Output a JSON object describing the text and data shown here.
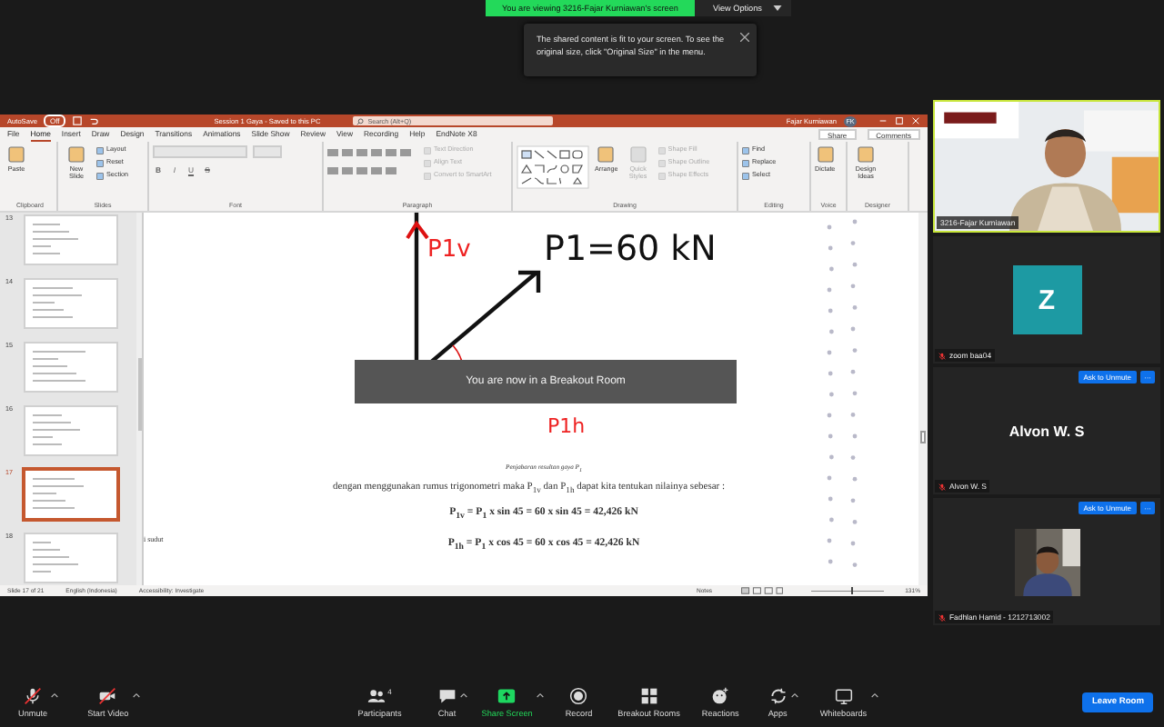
{
  "share_banner": {
    "text": "You are viewing 3216-Fajar Kurniawan's screen",
    "button": "View Options"
  },
  "tooltip": {
    "text": "The shared content is fit to your screen. To see the original size, click \"Original Size\" in the menu."
  },
  "powerpoint": {
    "title_bar": {
      "autosave": "AutoSave",
      "autosave_state": "Off",
      "document": "Session 1 Gaya  -  Saved to this PC",
      "search_placeholder": "Search (Alt+Q)",
      "user": "Fajar Kurniawan",
      "avatar": "FK"
    },
    "tabs": [
      {
        "label": "File",
        "selected": false
      },
      {
        "label": "Home",
        "selected": true
      },
      {
        "label": "Insert",
        "selected": false
      },
      {
        "label": "Draw",
        "selected": false
      },
      {
        "label": "Design",
        "selected": false
      },
      {
        "label": "Transitions",
        "selected": false
      },
      {
        "label": "Animations",
        "selected": false
      },
      {
        "label": "Slide Show",
        "selected": false
      },
      {
        "label": "Review",
        "selected": false
      },
      {
        "label": "View",
        "selected": false
      },
      {
        "label": "Recording",
        "selected": false
      },
      {
        "label": "Help",
        "selected": false
      },
      {
        "label": "EndNote X8",
        "selected": false
      }
    ],
    "share": "Share",
    "comments": "Comments",
    "ribbon": [
      {
        "kind": "plain",
        "label": "Clipboard",
        "items": [
          {
            "label": "Paste",
            "kind": "large",
            "disabled": false
          }
        ]
      },
      {
        "kind": "plain",
        "label": "Slides",
        "items": [
          {
            "label": "New Slide",
            "kind": "large",
            "disabled": false
          },
          {
            "label": "Layout",
            "kind": "small",
            "disabled": false
          },
          {
            "label": "Reset",
            "kind": "small",
            "disabled": false
          },
          {
            "label": "Section",
            "kind": "small",
            "disabled": false
          }
        ]
      },
      {
        "kind": "font",
        "label": "Font",
        "format_buttons": [
          "B",
          "I",
          "U",
          "S"
        ]
      },
      {
        "kind": "paragraph",
        "label": "Paragraph",
        "items": [
          {
            "label": "Text Direction",
            "kind": "small",
            "disabled": true
          },
          {
            "label": "Align Text",
            "kind": "small",
            "disabled": true
          },
          {
            "label": "Convert to SmartArt",
            "kind": "small",
            "disabled": true
          }
        ]
      },
      {
        "kind": "drawing",
        "label": "Drawing",
        "items": [
          {
            "label": "Arrange",
            "kind": "large",
            "disabled": false
          },
          {
            "label": "Quick Styles",
            "kind": "large",
            "disabled": true
          },
          {
            "label": "Shape Fill",
            "kind": "small",
            "disabled": true
          },
          {
            "label": "Shape Outline",
            "kind": "small",
            "disabled": true
          },
          {
            "label": "Shape Effects",
            "kind": "small",
            "disabled": true
          }
        ]
      },
      {
        "kind": "plain",
        "label": "Editing",
        "items": [
          {
            "label": "Find",
            "kind": "small",
            "disabled": false
          },
          {
            "label": "Replace",
            "kind": "small",
            "disabled": false
          },
          {
            "label": "Select",
            "kind": "small",
            "disabled": false
          }
        ]
      },
      {
        "kind": "plain",
        "label": "Voice",
        "items": [
          {
            "label": "Dictate",
            "kind": "large",
            "disabled": false
          }
        ]
      },
      {
        "kind": "plain",
        "label": "Designer",
        "items": [
          {
            "label": "Design Ideas",
            "kind": "large",
            "disabled": false
          }
        ]
      }
    ],
    "thumbnails": [
      {
        "number": "13",
        "selected": false
      },
      {
        "number": "14",
        "selected": false
      },
      {
        "number": "15",
        "selected": false
      },
      {
        "number": "16",
        "selected": false
      },
      {
        "number": "17",
        "selected": true
      },
      {
        "number": "18",
        "selected": false
      }
    ],
    "slide": {
      "ink_force": "P1=60 kN",
      "ink_vertical": "P1v",
      "ink_horizontal": "P1h",
      "side_text": "i sudut",
      "caption": "Penjabaran resultan gaya P$_{1}$",
      "paragraph": "dengan menggunakan rumus trigonometri maka P$_{1v}$ dan P$_{1h}$ dapat kita tentukan nilainya sebesar :",
      "equations": [
        "P$_{1v}$ = P$_{1}$ x sin 45 = 60 x sin 45 = 42,426 kN",
        "P$_{1h}$ = P$_{1}$ x cos 45 = 60 x cos 45 = 42,426 kN"
      ]
    },
    "overlay": "You are now in a Breakout Room",
    "status_bar": {
      "slide": "Slide 17 of 21",
      "language": "English (Indonesia)",
      "accessibility": "Accessibility: Investigate",
      "notes": "Notes",
      "zoom_slider": {
        "level": 0.55
      },
      "zoom": "131%"
    }
  },
  "participants": [
    {
      "kind": "video",
      "name": "3216-Fajar Kurniawan",
      "muted": false,
      "speaking": true
    },
    {
      "kind": "avatar",
      "initial": "Z",
      "name": "zoom baa04",
      "muted": true,
      "speaking": false
    },
    {
      "kind": "name",
      "display": "Alvon W. S",
      "name": "Alvon W. S",
      "button": "Ask to Unmute",
      "more": "···",
      "muted": true,
      "speaking": false
    },
    {
      "name": "Fadhlan Hamid - 1212713002",
      "button": "Ask to Unmute",
      "more": "···",
      "muted": true,
      "speaking": false
    }
  ],
  "toolbar": [
    {
      "kind": "mic",
      "label": "Unmute",
      "caret": true,
      "highlight": false
    },
    {
      "kind": "video",
      "label": "Start Video",
      "caret": true,
      "highlight": false
    },
    {
      "kind": "participants",
      "label": "Participants",
      "count": "4",
      "caret": false,
      "highlight": false
    },
    {
      "kind": "chat",
      "label": "Chat",
      "caret": true,
      "highlight": false
    },
    {
      "kind": "share",
      "label": "Share Screen",
      "caret": true,
      "highlight": true
    },
    {
      "kind": "record",
      "label": "Record",
      "caret": false,
      "highlight": false
    },
    {
      "kind": "rooms",
      "label": "Breakout Rooms",
      "caret": false,
      "highlight": false
    },
    {
      "kind": "reactions",
      "label": "Reactions",
      "caret": false,
      "highlight": false
    },
    {
      "kind": "apps",
      "label": "Apps",
      "caret": true,
      "highlight": false
    },
    {
      "kind": "whiteboard",
      "label": "Whiteboards",
      "caret": true,
      "highlight": false
    }
  ],
  "leave": "Leave Room"
}
